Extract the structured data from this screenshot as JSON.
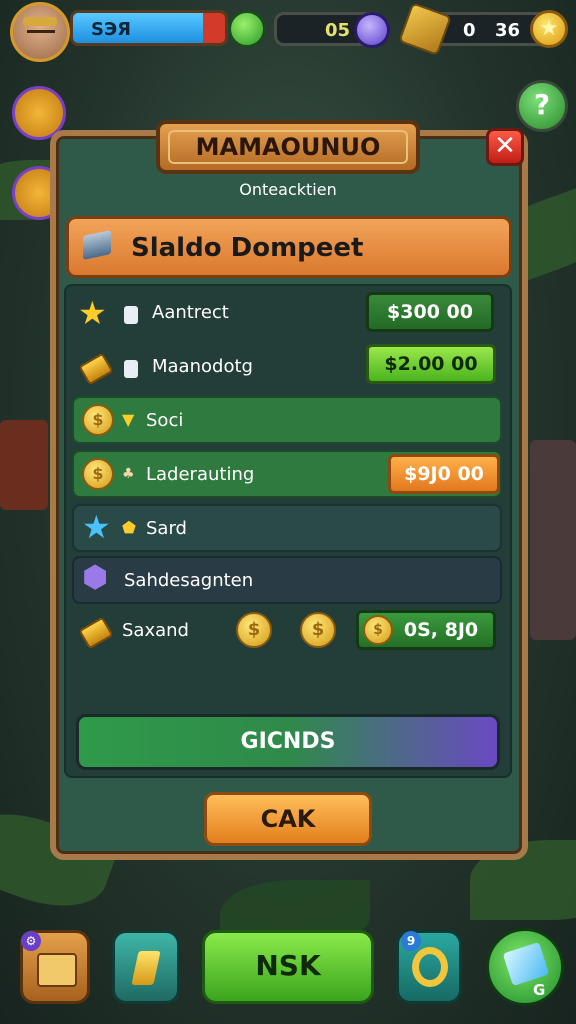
{
  "hud": {
    "player_name": "Sɐ͡ɐ",
    "player_name_text": "SЭЯ",
    "gems_value": "05",
    "gold_value_a": "0",
    "gold_value_b": "36",
    "help_label": "?"
  },
  "dialog": {
    "title": "MAMAOUNUO",
    "subtitle": "Onteacktien",
    "close_label": "✕",
    "wallet_label": "Slaldo Dompeet",
    "rows": [
      {
        "label": "Aantrect",
        "value": "$300 00"
      },
      {
        "label": "Maanodotg",
        "value": "$2.00 00"
      },
      {
        "label": "Soci",
        "value": ""
      },
      {
        "label": "Laderauting",
        "value": "$9J0 00"
      },
      {
        "label": "Sard",
        "value": ""
      },
      {
        "label": "Sahdesagnten",
        "value": ""
      },
      {
        "label": "Saxand",
        "value": "0S, 8J0"
      }
    ],
    "cta_label": "GICNDS",
    "ok_label": "CAK"
  },
  "bottom_nav": {
    "main_label": "NSK",
    "gem_label": "G",
    "ring_badge": "9"
  },
  "colors": {
    "panel": "#2f5a4a",
    "frame": "#a87a4a",
    "orange": "#e37f1e",
    "green": "#3aa41e",
    "purple": "#6a4ac2"
  }
}
